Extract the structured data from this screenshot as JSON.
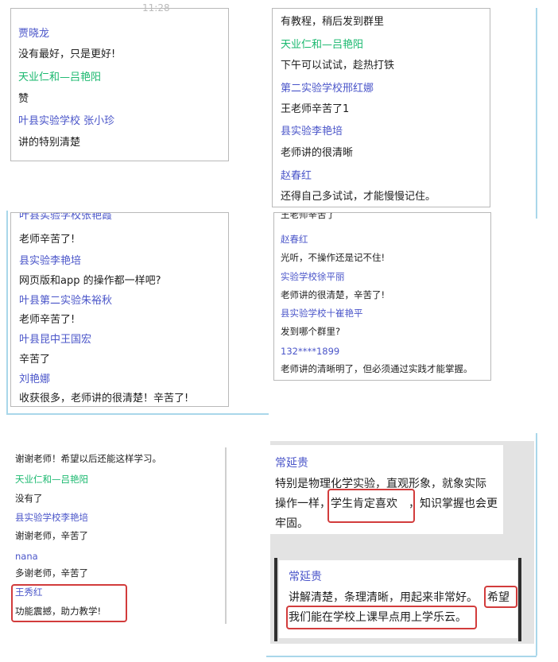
{
  "colors": {
    "name_blue": "#4a55c9",
    "name_green": "#19b86e",
    "text": "#1e1e1e",
    "highlight": "#d23c3c"
  },
  "clock_text": "11:28",
  "panel1": {
    "messages": [
      {
        "name": "贾晓龙",
        "text": "没有最好，只是更好!"
      },
      {
        "name": "天业仁和—吕艳阳",
        "text": "赞"
      },
      {
        "name": "叶县实验学校 张小珍",
        "text": "讲的特别清楚"
      }
    ]
  },
  "panel2": {
    "top_text": "有教程，稍后发到群里",
    "messages": [
      {
        "name": "天业仁和—吕艳阳",
        "text": "下午可以试试，趁热打铁"
      },
      {
        "name": "第二实验学校邢红娜",
        "text": "王老师辛苦了1"
      },
      {
        "name": "县实验李艳培",
        "text": "老师讲的很清晰"
      },
      {
        "name": "赵春红",
        "text": "还得自己多试试，才能慢慢记住。"
      }
    ]
  },
  "panel3": {
    "top_name": "叶县实验学校张艳霞",
    "top_text": "老师辛苦了!",
    "messages": [
      {
        "name": "县实验李艳培",
        "text": "网页版和app 的操作都一样吧?"
      },
      {
        "name": "叶县第二实验朱裕秋",
        "text": "老师辛苦了!"
      },
      {
        "name": "叶县昆中王国宏",
        "text": "辛苦了"
      },
      {
        "name": "刘艳娜",
        "text": "收获很多，老师讲的很清楚！辛苦了!"
      }
    ]
  },
  "panel4": {
    "top_text": "王老师辛苦了",
    "messages": [
      {
        "name": "赵春红",
        "text": "光听，不操作还是记不住!"
      },
      {
        "name": "实验学校徐平丽",
        "text": "老师讲的很清楚，辛苦了!"
      },
      {
        "name": "县实验学校十崔艳平",
        "text": "发到哪个群里?"
      },
      {
        "name": "132****1899",
        "text": "老师讲的清晰明了，但必须通过实践才能掌握。"
      }
    ]
  },
  "panel5": {
    "top_text": "谢谢老师！希望以后还能这样学习。",
    "messages": [
      {
        "name": "天业仁和—吕艳阳",
        "text": "没有了"
      },
      {
        "name": "县实验学校李艳培",
        "text": "谢谢老师，辛苦了"
      },
      {
        "name": "nana",
        "text": "多谢老师，辛苦了"
      },
      {
        "name": "王秀红",
        "text": "功能震撼，助力教学!"
      }
    ]
  },
  "panel6": {
    "msg1": {
      "name": "常延贵",
      "line1": "特别是物理化学实验，直观形象，就象实际",
      "line2a": "操作一样，",
      "line2b": "学生肯定喜欢",
      "line2c": "，知识掌握也会更",
      "line3": "牢固。"
    },
    "msg2": {
      "name": "常延贵",
      "line1a": "讲解清楚，条理清晰，用起来非常好。",
      "line1b": "希望",
      "line2": "我们能在学校上课早点用上学乐云。"
    }
  }
}
